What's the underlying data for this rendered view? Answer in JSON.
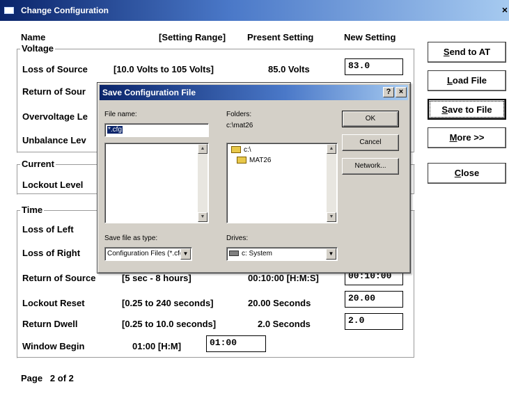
{
  "window": {
    "title": "Change Configuration",
    "close_label": "×"
  },
  "headers": {
    "name": "Name",
    "range": "[Setting Range]",
    "present": "Present Setting",
    "new": "New Setting"
  },
  "groups": {
    "voltage": "Voltage",
    "current": "Current",
    "time": "Time"
  },
  "rows": {
    "loss_of_source": {
      "label": "Loss of Source",
      "range": "[10.0 Volts to 105 Volts]",
      "present": "85.0 Volts",
      "new": "83.0"
    },
    "return_of_source_v": {
      "label": "Return of Sour"
    },
    "overvoltage": {
      "label": "Overvoltage Le"
    },
    "unbalance": {
      "label": "Unbalance Lev"
    },
    "lockout_level": {
      "label": "Lockout Level"
    },
    "loss_of_left": {
      "label": "Loss of Left"
    },
    "loss_of_right": {
      "label": "Loss of Right"
    },
    "return_of_source_t": {
      "label": "Return of Source",
      "range": "[5 sec - 8 hours]",
      "present": "00:10:00 [H:M:S]",
      "new": "00:10:00"
    },
    "lockout_reset": {
      "label": "Lockout Reset",
      "range": "[0.25 to 240 seconds]",
      "present": "20.00 Seconds",
      "new": "20.00"
    },
    "return_dwell": {
      "label": "Return Dwell",
      "range": "[0.25 to 10.0 seconds]",
      "present": "2.0 Seconds",
      "new": "2.0"
    },
    "window_begin": {
      "label": "Window Begin",
      "present": "01:00 [H:M]",
      "new": "01:00"
    }
  },
  "page": {
    "label": "Page",
    "value": "2 of 2"
  },
  "side_buttons": {
    "send_first": "S",
    "send_rest": "end to AT",
    "load_first": "L",
    "load_rest": "oad File",
    "save_first": "S",
    "save_rest": "ave to File",
    "more_first": "M",
    "more_rest": "ore >>",
    "close_first": "C",
    "close_rest": "lose"
  },
  "dialog": {
    "title": "Save Configuration File",
    "help_label": "?",
    "close_label": "×",
    "file_name_label": "File name:",
    "file_name_value": "*.cfg",
    "folders_label": "Folders:",
    "folders_path": "c:\\mat26",
    "folder_items": [
      "c:\\",
      "MAT26"
    ],
    "save_type_label": "Save file as type:",
    "save_type_value": "Configuration Files (*.cfg",
    "drives_label": "Drives:",
    "drives_value": "c: System",
    "ok_label": "OK",
    "cancel_label": "Cancel",
    "network_label": "Network..."
  }
}
